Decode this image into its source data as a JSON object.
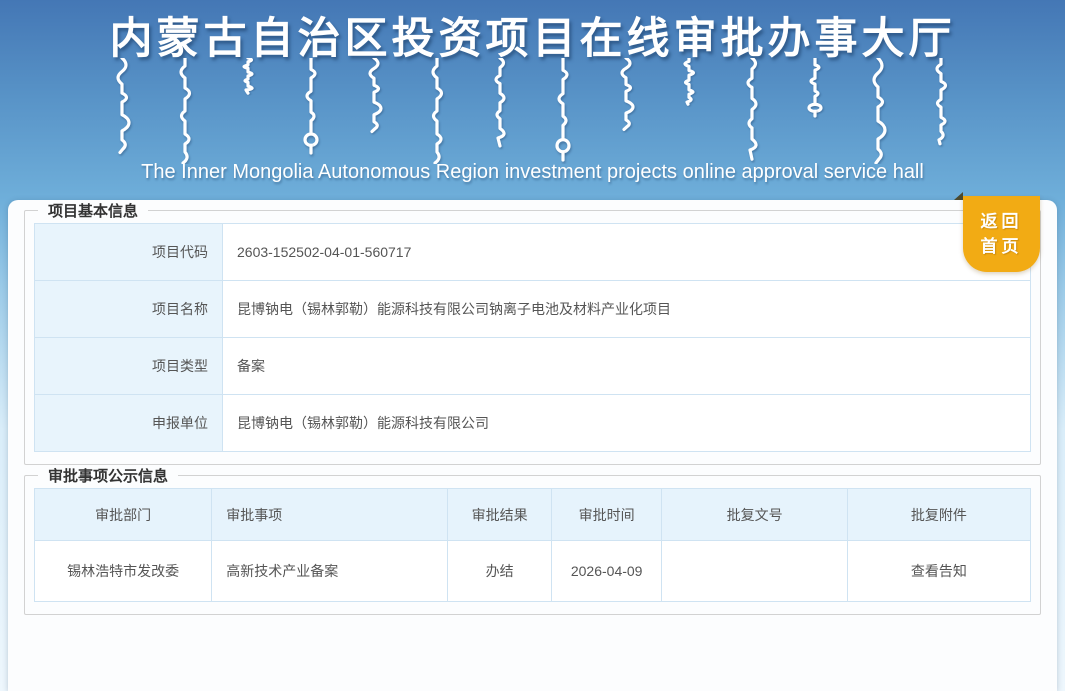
{
  "header": {
    "title_cn": "内蒙古自治区投资项目在线审批办事大厅",
    "subtitle_en": "The Inner Mongolia Autonomous Region investment projects online approval service hall"
  },
  "return_button": {
    "line1": "返回",
    "line2": "首页"
  },
  "basic_info": {
    "legend": "项目基本信息",
    "rows": [
      {
        "label": "项目代码",
        "value": "2603-152502-04-01-560717"
      },
      {
        "label": "项目名称",
        "value": "昆博钠电（锡林郭勒）能源科技有限公司钠离子电池及材料产业化项目"
      },
      {
        "label": "项目类型",
        "value": "备案"
      },
      {
        "label": "申报单位",
        "value": "昆博钠电（锡林郭勒）能源科技有限公司"
      }
    ]
  },
  "approval_info": {
    "legend": "审批事项公示信息",
    "columns": [
      "审批部门",
      "审批事项",
      "审批结果",
      "审批时间",
      "批复文号",
      "批复附件"
    ],
    "rows": [
      [
        "锡林浩特市发改委",
        "高新技术产业备案",
        "办结",
        "2026-04-09",
        "",
        "查看告知"
      ]
    ]
  },
  "colors": {
    "accent_orange": "#f2ab14",
    "header_blue_top": "#4477b5",
    "header_blue_bottom": "#6fafda",
    "table_header_bg": "#e6f3fc",
    "table_border": "#cfe3f2",
    "legend_text": "#333333",
    "body_text": "#555555"
  }
}
